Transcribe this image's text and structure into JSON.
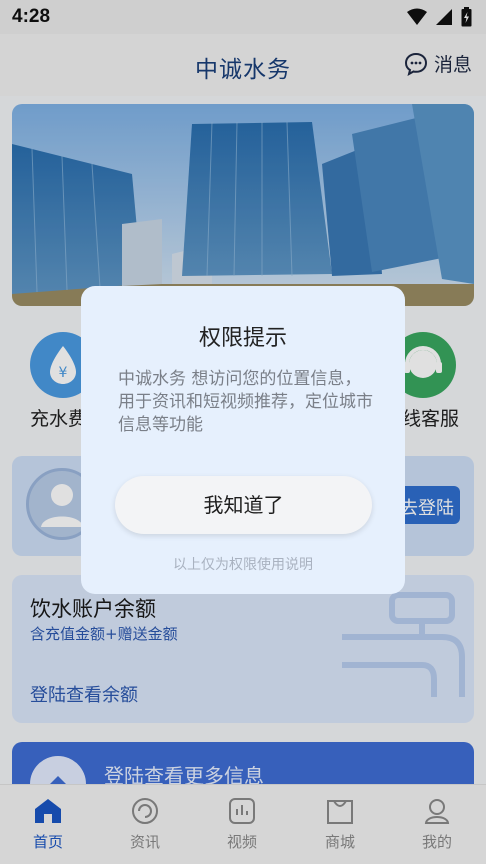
{
  "status_bar": {
    "time": "4:28"
  },
  "header": {
    "title": "中诚水务",
    "message_label": "消息"
  },
  "quick_actions": [
    {
      "label": "充水费",
      "icon": "yuan-drop-icon"
    },
    {
      "label": "线客服",
      "icon": "headset-icon"
    }
  ],
  "login_card": {
    "button_label": "去登陆"
  },
  "balance_card": {
    "title": "饮水账户余额",
    "subtitle": "含充值金额+赠送金额",
    "link": "登陆查看余额"
  },
  "more_card": {
    "title": "登陆查看更多信息"
  },
  "tabbar": {
    "items": [
      {
        "label": "首页",
        "icon": "home-icon"
      },
      {
        "label": "资讯",
        "icon": "refresh-icon"
      },
      {
        "label": "视频",
        "icon": "video-icon"
      },
      {
        "label": "商城",
        "icon": "shop-bag-icon"
      },
      {
        "label": "我的",
        "icon": "profile-icon"
      }
    ],
    "active_index": 0
  },
  "dialog": {
    "title": "权限提示",
    "body": "中诚水务 想访问您的位置信息，用于资讯和短视频推荐，定位城市信息等功能",
    "button": "我知道了",
    "note": "以上仅为权限使用说明"
  },
  "colors": {
    "accent": "#1a56c4",
    "dialog_bg": "#e6f0fd"
  }
}
